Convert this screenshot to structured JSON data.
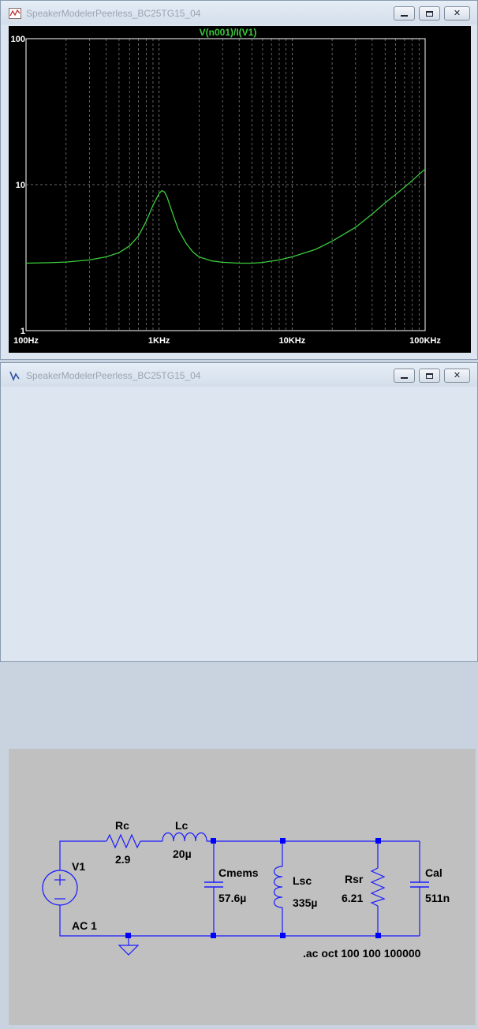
{
  "plot_window": {
    "title": "SpeakerModelerPeerless_BC25TG15_04",
    "controls": {
      "minimize": "",
      "maximize": "",
      "close": "✕"
    }
  },
  "schematic_window": {
    "title": "SpeakerModelerPeerless_BC25TG15_04",
    "controls": {
      "minimize": "",
      "maximize": "",
      "close": "✕"
    }
  },
  "colors": {
    "trace": "#3ccc3c",
    "plot_background": "#000000",
    "axis_text": "#ffffff",
    "wire": "#1a1aff",
    "junction": "#0000ff",
    "schematic_background": "#c0c0c0"
  },
  "chart_data": {
    "type": "line",
    "title": "V(n001)/I(V1)",
    "xlabel": "",
    "ylabel": "",
    "xscale": "log",
    "yscale": "log",
    "xlim": [
      100,
      100000
    ],
    "ylim": [
      1,
      100
    ],
    "x_ticks": [
      "100Hz",
      "1KHz",
      "10KHz",
      "100KHz"
    ],
    "y_ticks": [
      "1",
      "10",
      "100"
    ],
    "grid": true,
    "series": [
      {
        "x": [
          100,
          150,
          200,
          300,
          400,
          500,
          600,
          700,
          800,
          900,
          1000,
          1050,
          1100,
          1150,
          1200,
          1300,
          1400,
          1600,
          1800,
          2000,
          2500,
          3000,
          4000,
          5000,
          6000,
          8000,
          10000,
          15000,
          20000,
          30000,
          40000,
          50000,
          70000,
          100000
        ],
        "y": [
          2.9,
          2.92,
          2.95,
          3.05,
          3.2,
          3.42,
          3.8,
          4.45,
          5.6,
          7.2,
          8.7,
          9.1,
          8.9,
          8.2,
          7.3,
          5.9,
          4.9,
          3.95,
          3.45,
          3.2,
          3.0,
          2.94,
          2.9,
          2.9,
          2.93,
          3.05,
          3.2,
          3.6,
          4.1,
          5.1,
          6.3,
          7.5,
          9.6,
          12.8
        ]
      }
    ]
  },
  "schematic": {
    "components": {
      "V1": {
        "name": "V1",
        "value": "AC 1"
      },
      "Rc": {
        "name": "Rc",
        "value": "2.9"
      },
      "Lc": {
        "name": "Lc",
        "value": "20µ"
      },
      "Cmems": {
        "name": "Cmems",
        "value": "57.6µ"
      },
      "Lsc": {
        "name": "Lsc",
        "value": "335µ"
      },
      "Rsr": {
        "name": "Rsr",
        "value": "6.21"
      },
      "Cal": {
        "name": "Cal",
        "value": "511n"
      }
    },
    "directive": ".ac oct 100 100 100000"
  }
}
